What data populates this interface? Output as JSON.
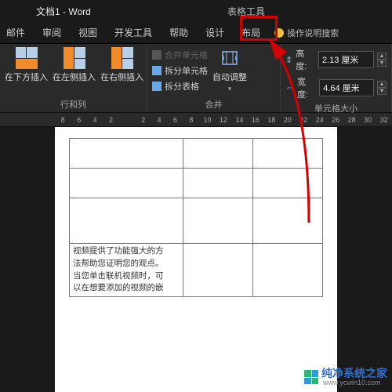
{
  "title": "文档1 - Word",
  "context_tab": "表格工具",
  "tabs": {
    "mail": "邮件",
    "review": "审阅",
    "view": "视图",
    "devtools": "开发工具",
    "help": "帮助",
    "design": "设计",
    "layout": "布局",
    "tellme": "操作说明搜索"
  },
  "ribbon": {
    "rows_cols": {
      "insert_below": "在下方插入",
      "insert_left": "在左侧插入",
      "insert_right": "在右侧插入",
      "label": "行和列"
    },
    "merge": {
      "merge_cells": "合并单元格",
      "split_cells": "拆分单元格",
      "split_table": "拆分表格",
      "autofit": "自动调整",
      "label": "合并"
    },
    "size": {
      "height_label": "高度:",
      "height_value": "2.13 厘米",
      "width_label": "宽度:",
      "width_value": "4.64 厘米",
      "label": "单元格大小"
    }
  },
  "ruler_ticks": [
    "8",
    "6",
    "4",
    "2",
    "",
    "2",
    "4",
    "6",
    "8",
    "10",
    "12",
    "14",
    "16",
    "18",
    "20",
    "22",
    "24",
    "26",
    "28",
    "30",
    "32"
  ],
  "doc": {
    "cell_text_lines": [
      "视频提供了功能强大的方",
      "法帮助您证明您的观点。",
      "当您单击联机视频时，可",
      "以在想要添加的视频的嵌"
    ]
  },
  "watermark": {
    "brand": "纯净系统之家",
    "url": "www.ycwin10.com"
  }
}
